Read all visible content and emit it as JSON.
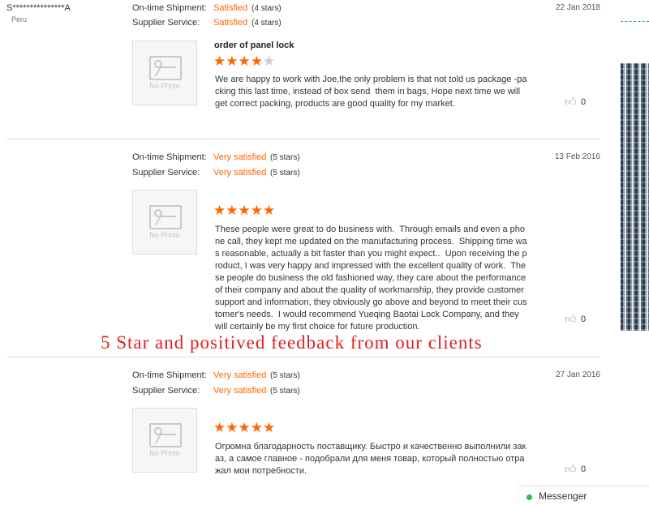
{
  "reviews": [
    {
      "buyer": "S***************A",
      "country": "Peru",
      "shipment_label": "On-time Shipment:",
      "shipment_rating": "Satisfied",
      "shipment_stars": "(4 stars)",
      "service_label": "Supplier Service:",
      "service_rating": "Satisfied",
      "service_stars": "(4 stars)",
      "date": "22 Jan 2018",
      "photo_text": "No Photo",
      "title": "order of panel lock",
      "stars": 4,
      "text": "We are happy to work with Joe,the only problem is that not told us package -packing this last time, instead of box send  them in bags, Hope next time we will get correct packing, products are good quality for my market.",
      "likes": "0"
    },
    {
      "shipment_label": "On-time Shipment:",
      "shipment_rating": "Very satisfied",
      "shipment_stars": "(5 stars)",
      "service_label": "Supplier Service:",
      "service_rating": "Very satisfied",
      "service_stars": "(5 stars)",
      "date": "13 Feb 2016",
      "photo_text": "No Photo",
      "stars": 5,
      "text": "These people were great to do business with.  Through emails and even a phone call, they kept me updated on the manufacturing process.  Shipping time was reasonable, actually a bit faster than you might expect..  Upon receiving the product, I was very happy and impressed with the excellent quality of work.  These people do business the old fashioned way, they care about the performance of their company and about the quality of workmanship, they provide customer support and information, they obviously go above and beyond to meet their customer's needs.  I would recommend Yueqing Baotai Lock Company, and they will certainly be my first choice for future production.",
      "likes": "0"
    },
    {
      "shipment_label": "On-time Shipment:",
      "shipment_rating": "Very satisfied",
      "shipment_stars": "(5 stars)",
      "service_label": "Supplier Service:",
      "service_rating": "Very satisfied",
      "service_stars": "(5 stars)",
      "date": "27 Jan 2016",
      "photo_text": "No Photo",
      "stars": 5,
      "text": "Огромна благодарность поставщику. Быстро и качественно выполнили заказ, а самое главное - подобрали для меня товар, который полностью отражал мои потребности.",
      "likes": "0"
    }
  ],
  "overlay_caption": "5 Star and positived feedback from our clients",
  "messenger": {
    "label": "Messenger"
  },
  "colors": {
    "accent": "#ff6600",
    "star_off": "#cccccc",
    "overlay": "#e02020",
    "online": "#2db84b"
  }
}
